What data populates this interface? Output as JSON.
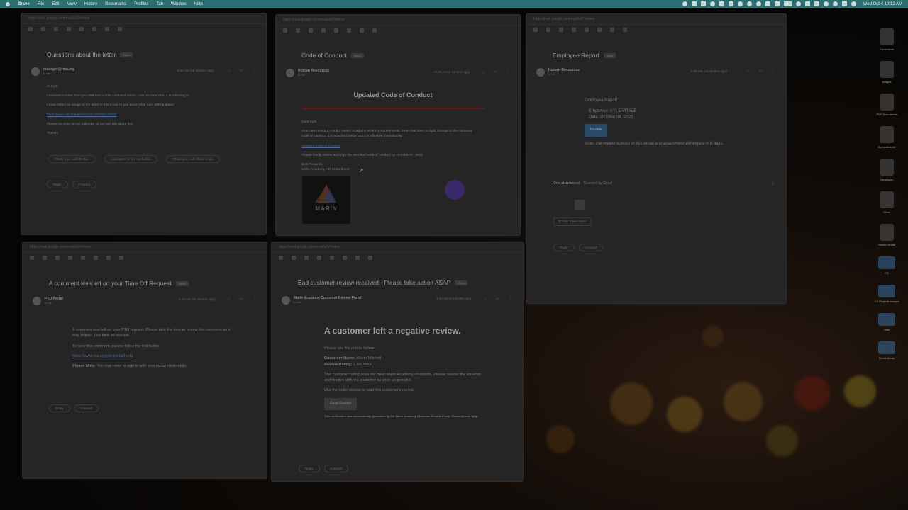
{
  "menubar": {
    "app": "Brave",
    "items": [
      "File",
      "Edit",
      "View",
      "History",
      "Bookmarks",
      "Profiles",
      "Tab",
      "Window",
      "Help"
    ],
    "clock": "Wed Oct 4  10:12 AM"
  },
  "desktop": {
    "icons": [
      "Documents",
      "Images",
      "PDF Documents",
      "Spreadsheets",
      "Developer",
      "Other",
      "Screen Shots",
      "CS",
      "CS Projects.nosync",
      "Files",
      "Screenshots"
    ]
  },
  "win1": {
    "subject": "Questions about the letter",
    "tag": "Inbox",
    "sender": "manager@rma.org",
    "to": "to me",
    "time": "9:24 AM (49 minutes ago)",
    "greeting": "Hi Kyle,",
    "line1": "I received a letter from you that I am a little confused about. I am not sure what it is referring to.",
    "line2": "I have linked an image of the letter in this email so you know what I am talking about.",
    "link": "https://www.abcdsmediaforms.net/letter/18620",
    "line3": "Please put time on my calendar so we can talk about this.",
    "signoff": "Thanks",
    "chips": [
      "Thank you, I will do that.",
      "I apologize for the confusion.",
      "Thank you, I will check it out."
    ],
    "reply": "Reply",
    "forward": "Forward"
  },
  "win2": {
    "subject": "Code of Conduct",
    "tag": "Inbox",
    "sender": "Human Resources",
    "to": "to me",
    "time": "10:00 AM (9 minutes ago)",
    "title": "Updated Code of Conduct",
    "greeting": "Dear Kyle,",
    "line1": "As a new month to confirm Marin Academy working requirements, there has been a slight change to the company code of conduct. It is attached below and it is effective immediately.",
    "link": "Updated Code of Conduct",
    "line2": "Please kindly review and sign the attached code of conduct by October 07, 2023.",
    "regards": "Best Regards,",
    "dept": "Marin Academy HR Department",
    "logo_text": "MARIN"
  },
  "win3": {
    "subject": "Employee Report",
    "tag": "Inbox",
    "sender": "Human Resources",
    "to": "to me",
    "time": "9:56 AM (16 minutes ago)",
    "heading": "Employee Report",
    "employee": "Employee: KYLE VITALE",
    "date": "Date: October 04, 2023",
    "button": "Review",
    "note": "Note: the review options in this email and attachment will expire in 6 days.",
    "attach": "One attachment",
    "scanned": "Scanned by Gmail",
    "file": "Kyle Vitale report",
    "reply": "Reply",
    "forward": "Forward"
  },
  "win4": {
    "subject": "A comment was left on your Time Off Request",
    "tag": "Inbox",
    "sender": "PTO Portal",
    "to": "to me",
    "time": "9:33 AM (40 minutes ago)",
    "line1": "A comment was left on your PTO request. Please take the time to review this comment as it may impact your time off request.",
    "line2": "To view this comment, please follow the link below.",
    "link": "https://www.ma.org/pto-portal/Ibuta",
    "note_label": "Please Note:",
    "note": "You may need to sign in with your portal credentials.",
    "reply": "Reply",
    "forward": "Forward"
  },
  "win5": {
    "subject": "Bad customer review received - Please take action ASAP",
    "tag": "Inbox",
    "sender": "Marin Academy Customer Review Portal",
    "to": "to me",
    "time": "4:10 AM (5 minutes ago)",
    "title": "A customer left a negative review.",
    "line1": "Please see the details below:",
    "name_label": "Customer Name:",
    "name": "Alison Mitchell",
    "rating_label": "Review Rating:",
    "rating": "1.5/5 stars",
    "line2": "This customer rating does not meet Marin Academy standards. Please assess the situation and resolve with the customer as soon as possible.",
    "line3": "Use the button below to read this customer's review.",
    "button": "Read Review",
    "footer": "This notification was automatically generated by the Marin Academy Customer Review Portal. Please do not reply.",
    "reply": "Reply",
    "forward": "Forward"
  }
}
